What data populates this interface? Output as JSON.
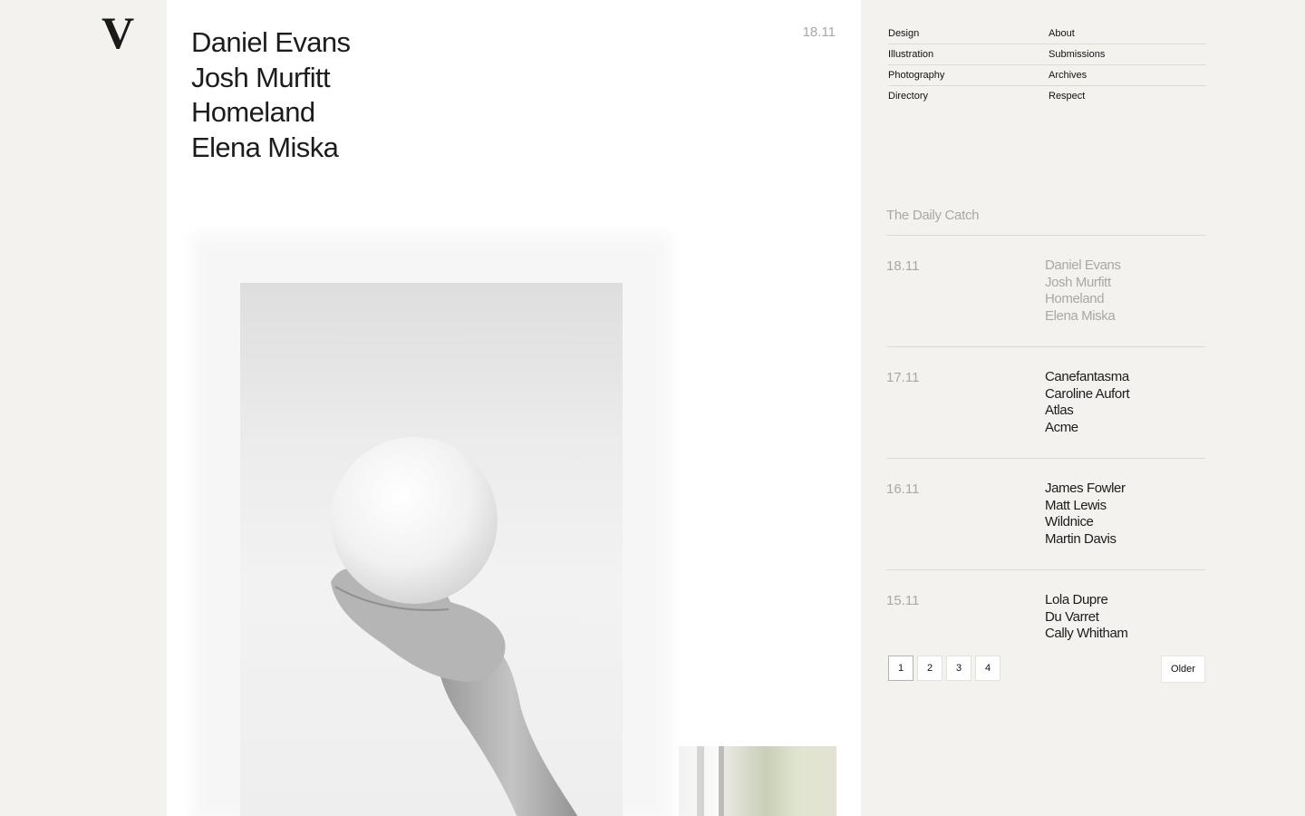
{
  "logo": {
    "text": "V"
  },
  "post": {
    "date": "18.11",
    "names": [
      "Daniel Evans",
      "Josh Murfitt",
      "Homeland",
      "Elena Miska"
    ]
  },
  "nav": {
    "items": [
      "Design",
      "About",
      "Illustration",
      "Submissions",
      "Photography",
      "Archives",
      "Directory",
      "Respect"
    ]
  },
  "daily": {
    "title": "The Daily Catch",
    "entries": [
      {
        "date": "18.11",
        "names": [
          "Daniel Evans",
          "Josh Murfitt",
          "Homeland",
          "Elena Miska"
        ]
      },
      {
        "date": "17.11",
        "names": [
          "Canefantasma",
          "Caroline Aufort",
          "Atlas",
          "Acme"
        ]
      },
      {
        "date": "16.11",
        "names": [
          "James Fowler",
          "Matt Lewis",
          "Wildnice",
          "Martin Davis"
        ]
      },
      {
        "date": "15.11",
        "names": [
          "Lola Dupre",
          "Du Varret",
          "Cally Whitham"
        ]
      }
    ]
  },
  "pagination": {
    "pages": [
      "1",
      "2",
      "3",
      "4"
    ],
    "current": "1",
    "older_label": "Older"
  }
}
